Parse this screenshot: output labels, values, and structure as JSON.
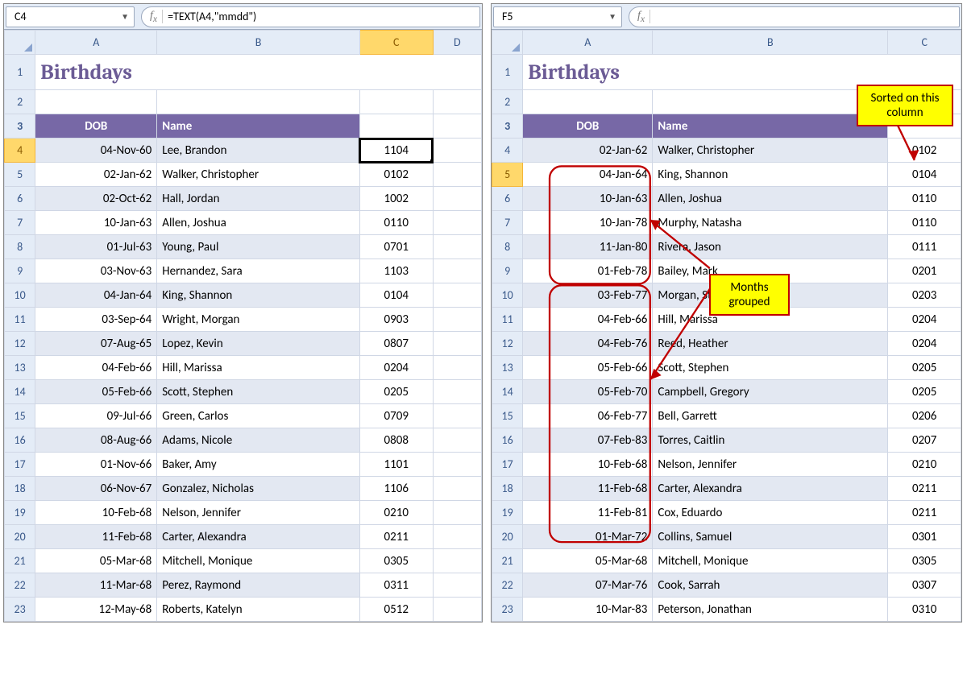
{
  "left": {
    "namebox": "C4",
    "formula": "=TEXT(A4,\"mmdd\")",
    "title": "Birthdays",
    "cols": [
      "A",
      "B",
      "C",
      "D"
    ],
    "headers": {
      "dob": "DOB",
      "name": "Name"
    },
    "active_col": "C",
    "active_row": 4,
    "rows": [
      {
        "n": 4,
        "dob": "04-Nov-60",
        "name": "Lee, Brandon",
        "code": "1104"
      },
      {
        "n": 5,
        "dob": "02-Jan-62",
        "name": "Walker, Christopher",
        "code": "0102"
      },
      {
        "n": 6,
        "dob": "02-Oct-62",
        "name": "Hall, Jordan",
        "code": "1002"
      },
      {
        "n": 7,
        "dob": "10-Jan-63",
        "name": "Allen, Joshua",
        "code": "0110"
      },
      {
        "n": 8,
        "dob": "01-Jul-63",
        "name": "Young, Paul",
        "code": "0701"
      },
      {
        "n": 9,
        "dob": "03-Nov-63",
        "name": "Hernandez, Sara",
        "code": "1103"
      },
      {
        "n": 10,
        "dob": "04-Jan-64",
        "name": "King, Shannon",
        "code": "0104"
      },
      {
        "n": 11,
        "dob": "03-Sep-64",
        "name": "Wright, Morgan",
        "code": "0903"
      },
      {
        "n": 12,
        "dob": "07-Aug-65",
        "name": "Lopez, Kevin",
        "code": "0807"
      },
      {
        "n": 13,
        "dob": "04-Feb-66",
        "name": "Hill, Marissa",
        "code": "0204"
      },
      {
        "n": 14,
        "dob": "05-Feb-66",
        "name": "Scott, Stephen",
        "code": "0205"
      },
      {
        "n": 15,
        "dob": "09-Jul-66",
        "name": "Green, Carlos",
        "code": "0709"
      },
      {
        "n": 16,
        "dob": "08-Aug-66",
        "name": "Adams, Nicole",
        "code": "0808"
      },
      {
        "n": 17,
        "dob": "01-Nov-66",
        "name": "Baker, Amy",
        "code": "1101"
      },
      {
        "n": 18,
        "dob": "06-Nov-67",
        "name": "Gonzalez, Nicholas",
        "code": "1106"
      },
      {
        "n": 19,
        "dob": "10-Feb-68",
        "name": "Nelson, Jennifer",
        "code": "0210"
      },
      {
        "n": 20,
        "dob": "11-Feb-68",
        "name": "Carter, Alexandra",
        "code": "0211"
      },
      {
        "n": 21,
        "dob": "05-Mar-68",
        "name": "Mitchell, Monique",
        "code": "0305"
      },
      {
        "n": 22,
        "dob": "11-Mar-68",
        "name": "Perez, Raymond",
        "code": "0311"
      },
      {
        "n": 23,
        "dob": "12-May-68",
        "name": "Roberts, Katelyn",
        "code": "0512"
      }
    ]
  },
  "right": {
    "namebox": "F5",
    "formula": "",
    "title": "Birthdays",
    "cols": [
      "A",
      "B",
      "C"
    ],
    "headers": {
      "dob": "DOB",
      "name": "Name"
    },
    "active_row": 5,
    "rows": [
      {
        "n": 4,
        "dob": "02-Jan-62",
        "name": "Walker, Christopher",
        "code": "0102"
      },
      {
        "n": 5,
        "dob": "04-Jan-64",
        "name": "King, Shannon",
        "code": "0104"
      },
      {
        "n": 6,
        "dob": "10-Jan-63",
        "name": "Allen, Joshua",
        "code": "0110"
      },
      {
        "n": 7,
        "dob": "10-Jan-78",
        "name": "Murphy, Natasha",
        "code": "0110"
      },
      {
        "n": 8,
        "dob": "11-Jan-80",
        "name": "Rivera, Jason",
        "code": "0111"
      },
      {
        "n": 9,
        "dob": "01-Feb-78",
        "name": "Bailey, Mark",
        "code": "0201"
      },
      {
        "n": 10,
        "dob": "03-Feb-77",
        "name": "Morgan, Steven",
        "code": "0203"
      },
      {
        "n": 11,
        "dob": "04-Feb-66",
        "name": "Hill, Marissa",
        "code": "0204"
      },
      {
        "n": 12,
        "dob": "04-Feb-76",
        "name": "Reed, Heather",
        "code": "0204"
      },
      {
        "n": 13,
        "dob": "05-Feb-66",
        "name": "Scott, Stephen",
        "code": "0205"
      },
      {
        "n": 14,
        "dob": "05-Feb-70",
        "name": "Campbell, Gregory",
        "code": "0205"
      },
      {
        "n": 15,
        "dob": "06-Feb-77",
        "name": "Bell, Garrett",
        "code": "0206"
      },
      {
        "n": 16,
        "dob": "07-Feb-83",
        "name": "Torres, Caitlin",
        "code": "0207"
      },
      {
        "n": 17,
        "dob": "10-Feb-68",
        "name": "Nelson, Jennifer",
        "code": "0210"
      },
      {
        "n": 18,
        "dob": "11-Feb-68",
        "name": "Carter, Alexandra",
        "code": "0211"
      },
      {
        "n": 19,
        "dob": "11-Feb-81",
        "name": "Cox, Eduardo",
        "code": "0211"
      },
      {
        "n": 20,
        "dob": "01-Mar-72",
        "name": "Collins, Samuel",
        "code": "0301"
      },
      {
        "n": 21,
        "dob": "05-Mar-68",
        "name": "Mitchell, Monique",
        "code": "0305"
      },
      {
        "n": 22,
        "dob": "07-Mar-76",
        "name": "Cook, Sarrah",
        "code": "0307"
      },
      {
        "n": 23,
        "dob": "10-Mar-83",
        "name": "Peterson, Jonathan",
        "code": "0310"
      }
    ],
    "callout_sorted": "Sorted on this column",
    "callout_grouped": "Months grouped"
  }
}
